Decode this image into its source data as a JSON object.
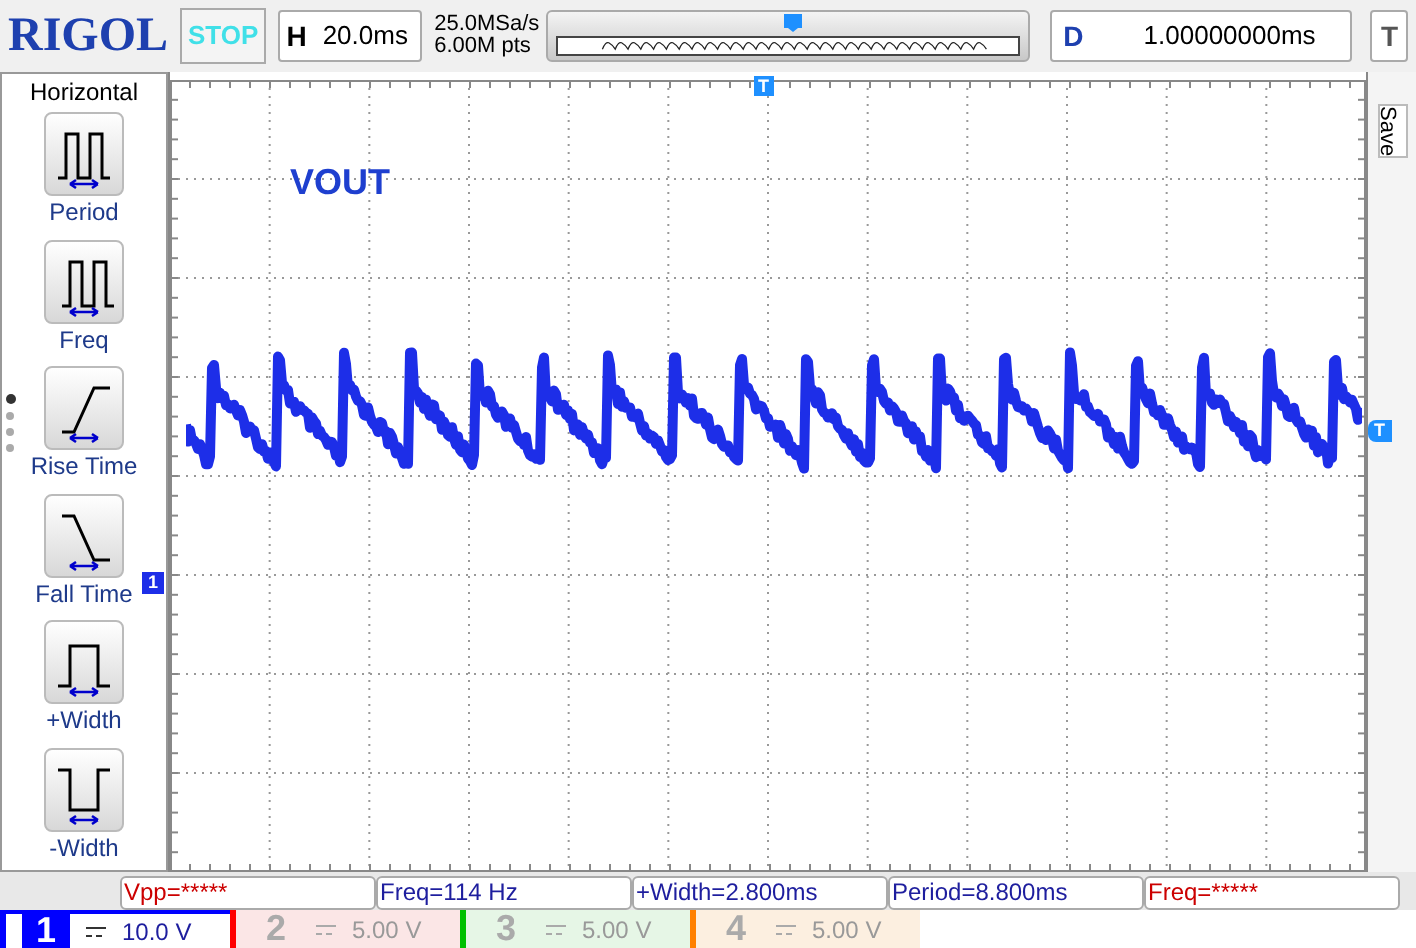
{
  "brand": "RIGOL",
  "run_state": "STOP",
  "horizontal": {
    "label": "H",
    "timebase": "20.0ms"
  },
  "sample": {
    "rate": "25.0MSa/s",
    "depth": "6.00M pts"
  },
  "delay": {
    "label": "D",
    "value": "1.00000000ms"
  },
  "trigger": {
    "label": "T"
  },
  "side_menu": {
    "title": "Horizontal",
    "items": [
      {
        "label": "Period",
        "kind": "period"
      },
      {
        "label": "Freq",
        "kind": "freq"
      },
      {
        "label": "Rise Time",
        "kind": "rise"
      },
      {
        "label": "Fall Time",
        "kind": "fall"
      },
      {
        "label": "+Width",
        "kind": "pwidth"
      },
      {
        "label": "-Width",
        "kind": "nwidth"
      }
    ],
    "pages": [
      {
        "selected": true
      },
      {
        "selected": false
      },
      {
        "selected": false
      },
      {
        "selected": false
      }
    ]
  },
  "right_tab": "Save",
  "screen": {
    "trace_label": "VOUT",
    "trigger_position": "T",
    "channel_marker": "1",
    "trigger_level": "T"
  },
  "measurements": [
    {
      "text": "Vpp=*****",
      "valid": false
    },
    {
      "text": "Freq=114 Hz",
      "valid": true
    },
    {
      "text": "+Width=2.800ms",
      "valid": true
    },
    {
      "text": "Period=8.800ms",
      "valid": true
    },
    {
      "text": "Freq=*****",
      "valid": false
    }
  ],
  "channels": [
    {
      "number": "1",
      "scale": "10.0 V",
      "enabled": true,
      "color": "#0000ff"
    },
    {
      "number": "2",
      "scale": "5.00 V",
      "enabled": false,
      "color": "#ff0000"
    },
    {
      "number": "3",
      "scale": "5.00 V",
      "enabled": false,
      "color": "#00c000"
    },
    {
      "number": "4",
      "scale": "5.00 V",
      "enabled": false,
      "color": "#ff8000"
    }
  ]
}
